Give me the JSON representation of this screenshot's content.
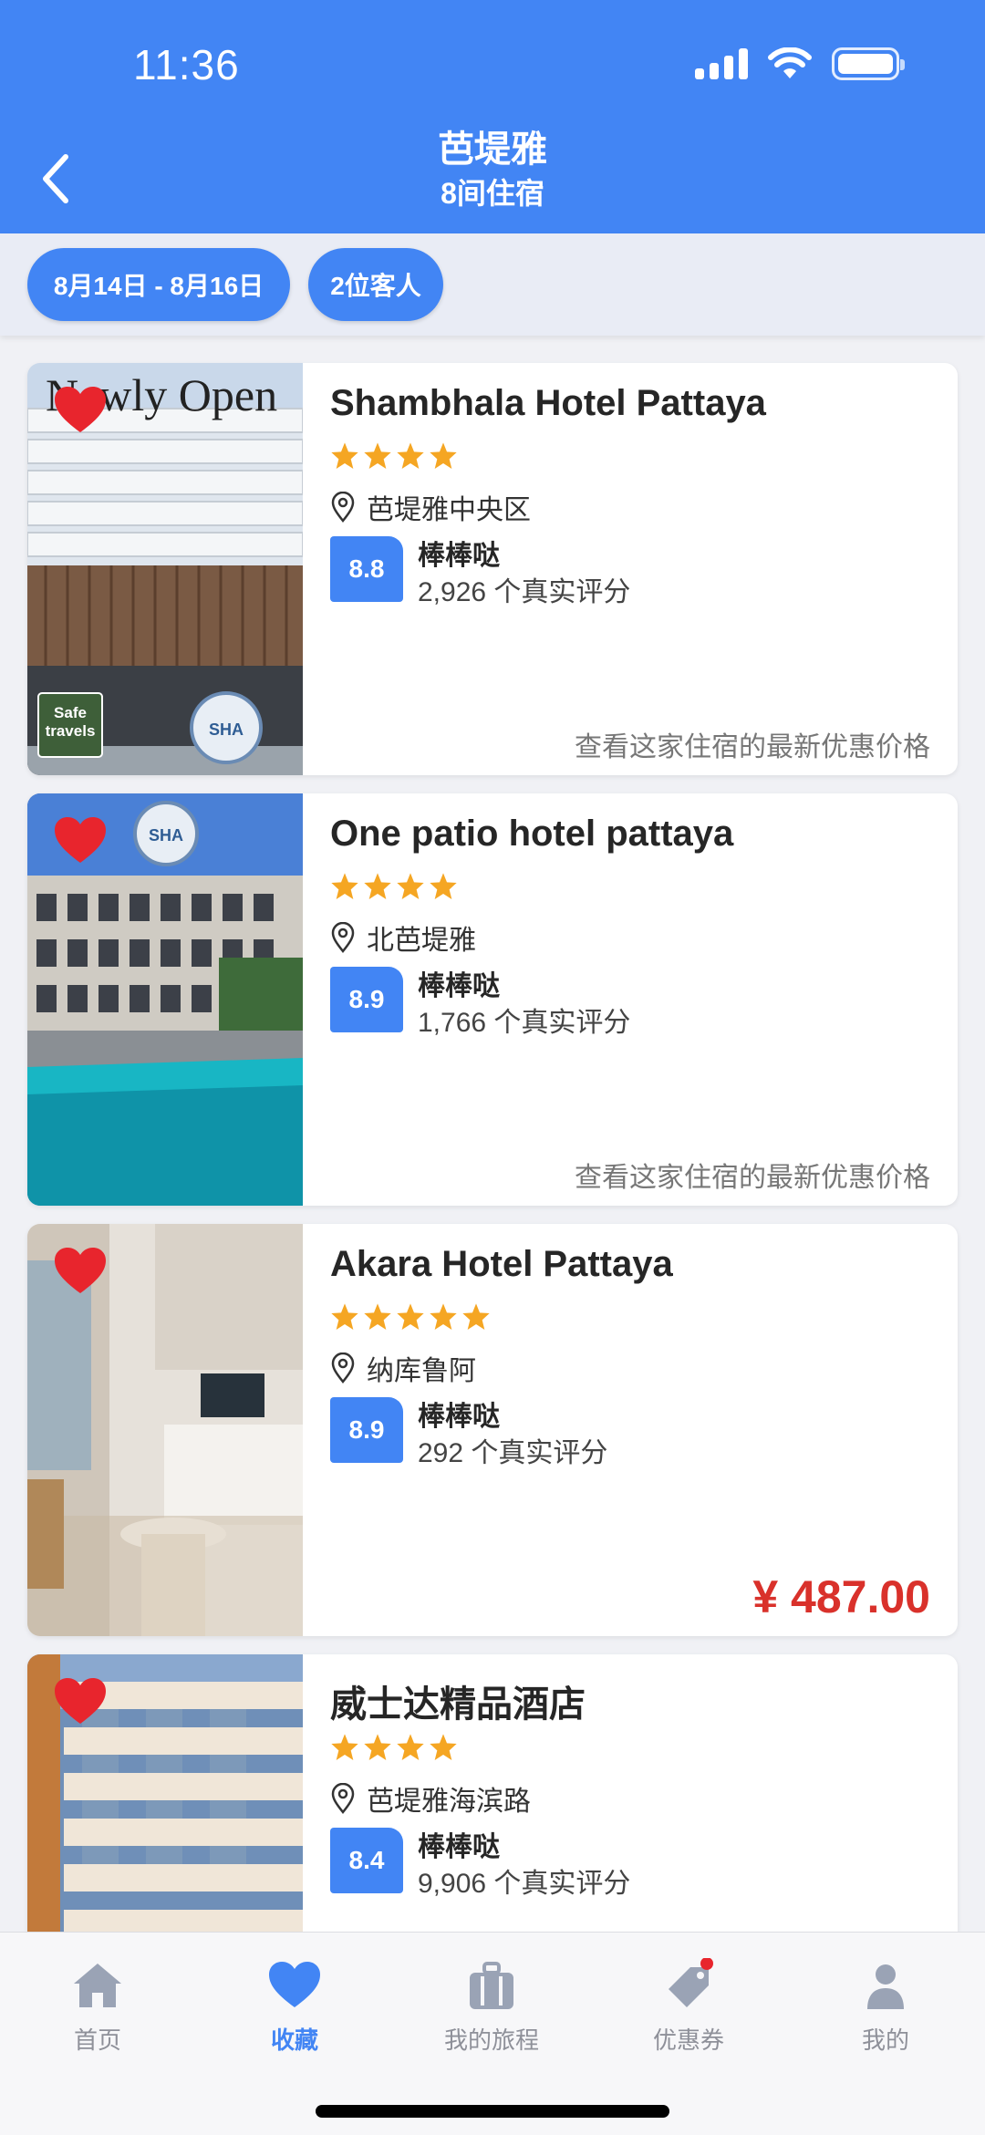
{
  "status_bar": {
    "time": "11:36"
  },
  "header": {
    "title": "芭堤雅",
    "subtitle": "8间住宿"
  },
  "filters": {
    "dates": "8月14日 - 8月16日",
    "guests": "2位客人"
  },
  "hotels": [
    {
      "name": "Shambhala Hotel Pattaya",
      "stars": 4,
      "location": "芭堤雅中央区",
      "rating": "8.8",
      "rating_label": "棒棒哒",
      "review_count": "2,926 个真实评分",
      "price_note": "查看这家住宿的最新优惠价格",
      "price": "",
      "image_overlay_text": "Newly Open",
      "badge_text": "Safe travels"
    },
    {
      "name": "One patio hotel pattaya",
      "stars": 4,
      "location": "北芭堤雅",
      "rating": "8.9",
      "rating_label": "棒棒哒",
      "review_count": "1,766 个真实评分",
      "price_note": "查看这家住宿的最新优惠价格",
      "price": ""
    },
    {
      "name": "Akara Hotel Pattaya",
      "stars": 5,
      "location": "纳库鲁阿",
      "rating": "8.9",
      "rating_label": "棒棒哒",
      "review_count": "292 个真实评分",
      "price_note": "",
      "price": "¥ 487.00"
    },
    {
      "name": "威士达精品酒店",
      "stars": 4,
      "location": "芭堤雅海滨路",
      "rating": "8.4",
      "rating_label": "棒棒哒",
      "review_count": "9,906 个真实评分",
      "price_note": "",
      "price": ""
    }
  ],
  "nav": [
    {
      "label": "首页",
      "icon": "home-icon",
      "active": false
    },
    {
      "label": "收藏",
      "icon": "heart-icon",
      "active": true
    },
    {
      "label": "我的旅程",
      "icon": "suitcase-icon",
      "active": false
    },
    {
      "label": "优惠券",
      "icon": "tag-icon",
      "active": false
    },
    {
      "label": "我的",
      "icon": "user-icon",
      "active": false
    }
  ],
  "colors": {
    "primary": "#4285f4",
    "price": "#d9312b",
    "star": "#f5a623",
    "heart": "#e8252d"
  }
}
